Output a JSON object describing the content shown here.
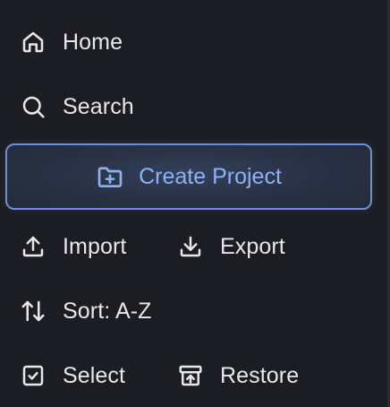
{
  "nav": {
    "home": {
      "label": "Home",
      "icon": "home-icon"
    },
    "search": {
      "label": "Search",
      "icon": "search-icon"
    },
    "create_project": {
      "label": "Create Project",
      "icon": "folder-plus-icon"
    },
    "import": {
      "label": "Import",
      "icon": "upload-icon"
    },
    "export": {
      "label": "Export",
      "icon": "download-icon"
    },
    "sort": {
      "label": "Sort: A-Z",
      "icon": "sort-arrows-icon"
    },
    "select": {
      "label": "Select",
      "icon": "checkbox-icon"
    },
    "restore": {
      "label": "Restore",
      "icon": "archive-restore-icon"
    }
  },
  "colors": {
    "background": "#1c1d22",
    "text": "#e7e8ec",
    "accent": "#8fb0f2",
    "accent_border": "#6f8fd4"
  }
}
